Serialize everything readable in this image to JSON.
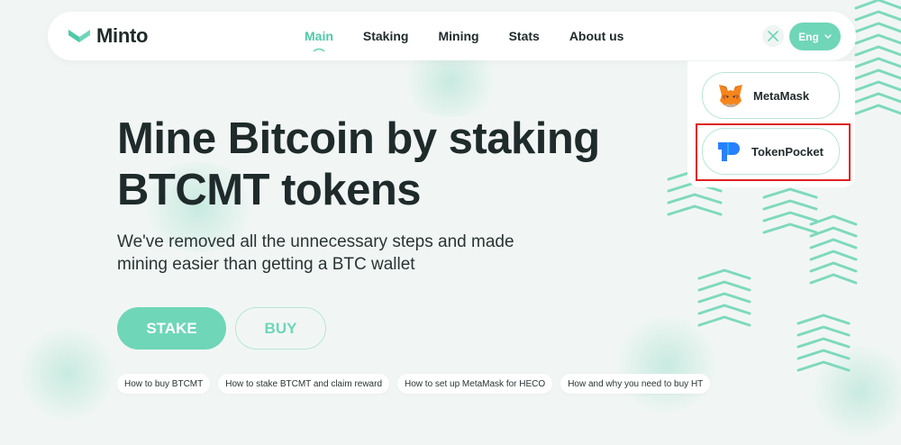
{
  "brand": {
    "name": "Minto",
    "accent": "#6fd6b8",
    "logo_icon": "minto-logo-icon"
  },
  "nav": {
    "items": [
      {
        "label": "Main",
        "active": true
      },
      {
        "label": "Staking",
        "active": false
      },
      {
        "label": "Mining",
        "active": false
      },
      {
        "label": "Stats",
        "active": false
      },
      {
        "label": "About us",
        "active": false
      }
    ]
  },
  "header_controls": {
    "close_icon": "close-icon",
    "language": "Eng",
    "language_icon": "chevron-down-icon"
  },
  "wallets": [
    {
      "label": "MetaMask",
      "icon": "metamask-fox-icon"
    },
    {
      "label": "TokenPocket",
      "icon": "tokenpocket-icon",
      "highlighted": true
    }
  ],
  "hero": {
    "title_line1": "Mine Bitcoin by staking",
    "title_line2": "BTCMT tokens",
    "subtitle_line1": "We've removed all the unnecessary steps and made",
    "subtitle_line2": "mining easier than getting a BTC wallet",
    "stake_label": "STAKE",
    "buy_label": "BUY"
  },
  "help_links": [
    "How to buy BTCMT",
    "How to stake BTCMT and claim reward",
    "How to set up MetaMask for HECO",
    "How and why you need to buy HT"
  ],
  "colors": {
    "highlight_border": "#e02020",
    "text": "#1f2a2a",
    "background": "#f1f6f4"
  }
}
